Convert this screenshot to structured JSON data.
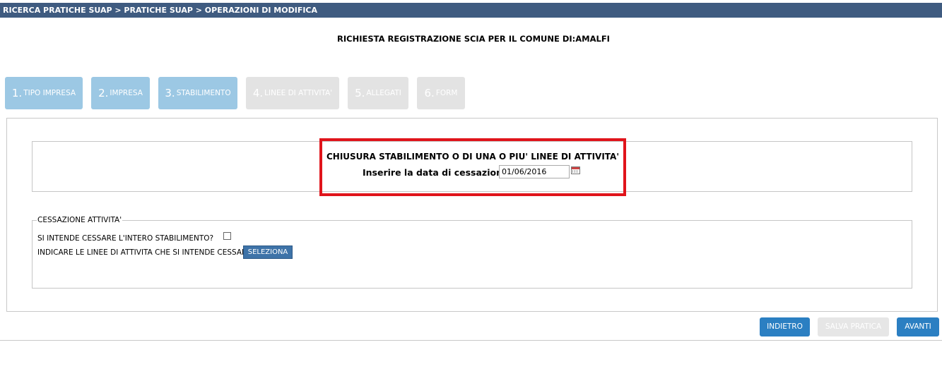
{
  "breadcrumb": "RICERCA PRATICHE SUAP > PRATICHE SUAP > OPERAZIONI DI MODIFICA",
  "page_title": "RICHIESTA REGISTRAZIONE SCIA PER IL COMUNE DI:AMALFI",
  "steps": [
    {
      "num": "1.",
      "label": "TIPO IMPRESA",
      "state": "active"
    },
    {
      "num": "2.",
      "label": "IMPRESA",
      "state": "active"
    },
    {
      "num": "3.",
      "label": "STABILIMENTO",
      "state": "active"
    },
    {
      "num": "4.",
      "label": "LINEE DI ATTIVITA'",
      "state": "disabled"
    },
    {
      "num": "5.",
      "label": "ALLEGATI",
      "state": "disabled"
    },
    {
      "num": "6.",
      "label": "FORM",
      "state": "disabled"
    }
  ],
  "closure": {
    "title": "CHIUSURA STABILIMENTO O DI UNA O PIU' LINEE DI ATTIVITA'",
    "date_label": "Inserire la data di cessazione",
    "date_value": "01/06/2016",
    "calendar_icon": "calendar-icon"
  },
  "cessazione": {
    "legend": "CESSAZIONE ATTIVITA'",
    "question_whole": "SI INTENDE CESSARE L'INTERO STABILIMENTO?",
    "whole_checked": false,
    "question_lines": "INDICARE LE LINEE DI ATTIVITA CHE SI INTENDE CESSARE",
    "select_button": "SELEZIONA"
  },
  "actions": {
    "back": "INDIETRO",
    "save": "SALVA PRATICA",
    "next": "AVANTI"
  },
  "colors": {
    "topbar": "#3f5b80",
    "step_active": "#9cc8e4",
    "step_disabled": "#e3e3e3",
    "primary_button": "#2b7fc2",
    "highlight": "#e0141b"
  }
}
